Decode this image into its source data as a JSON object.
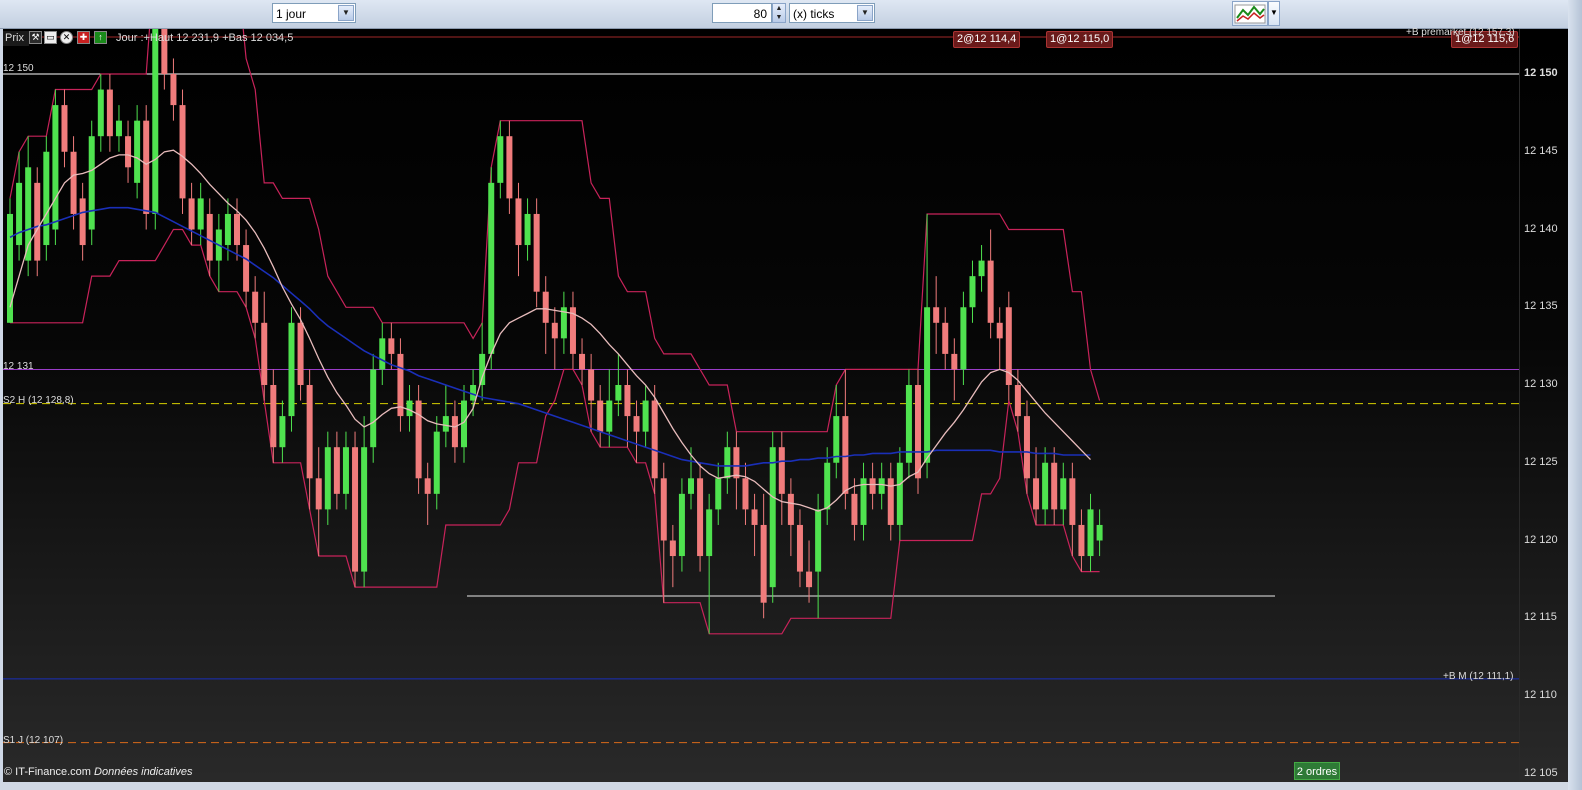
{
  "toolbar": {
    "period_value": "1 jour",
    "tick_count": "80",
    "tick_unit": "(x) ticks"
  },
  "chart_header": {
    "prix_label": "Prix",
    "info_text": "Jour :+Haut 12 231,9 +Bas 12 034,5"
  },
  "orders": [
    {
      "label": "2@12 114,4"
    },
    {
      "label": "1@12 115,0"
    },
    {
      "label": "1@12 115,6"
    }
  ],
  "level_labels": {
    "premarket": "+B premarket (12 157,3)",
    "l12150": "12 150",
    "l12131": "12 131",
    "s2h": "S2 H (12 128,8)",
    "bm": "+B M (12 111,1)",
    "s1j": "S1 J (12 107)"
  },
  "footer": {
    "brand": "© IT-Finance.com",
    "note": "Données indicatives",
    "orders_button": "2 ordres"
  },
  "colors": {
    "up": "#4fe24f",
    "down": "#f07c7c",
    "ma_blue": "#1a2fb8",
    "ma_pink": "#e8bcbc",
    "envelope": "#c8235a",
    "s2h": "#d8d000",
    "s1j": "#d86a1a",
    "bm": "#1a2fb8",
    "l12131": "#9a3cc8",
    "l12150": "#ffffff"
  },
  "chart_data": {
    "type": "candlestick",
    "y_ticks": [
      12150,
      12145,
      12140,
      12135,
      12130,
      12125,
      12120,
      12115,
      12110,
      12105
    ],
    "y_tick_labels": [
      "12 150",
      "12 145",
      "12 140",
      "12 135",
      "12 130",
      "12 125",
      "12 120",
      "12 115",
      "12 110",
      "12 105"
    ],
    "ylim": [
      12103.5,
      12155
    ],
    "levels": {
      "l12150": 12150,
      "l12131": 12131,
      "s2h": 12128.8,
      "bm": 12111.1,
      "s1j": 12107,
      "premarket": 12157.3
    },
    "candles": [
      {
        "o": 12134,
        "c": 12141,
        "h": 12142,
        "l": 12134
      },
      {
        "o": 12139,
        "c": 12143,
        "h": 12145,
        "l": 12138
      },
      {
        "o": 12138,
        "c": 12144,
        "h": 12146,
        "l": 12137
      },
      {
        "o": 12143,
        "c": 12138,
        "h": 12144,
        "l": 12137
      },
      {
        "o": 12139,
        "c": 12145,
        "h": 12146,
        "l": 12138
      },
      {
        "o": 12140,
        "c": 12148,
        "h": 12149,
        "l": 12139
      },
      {
        "o": 12148,
        "c": 12145,
        "h": 12149,
        "l": 12144
      },
      {
        "o": 12145,
        "c": 12141,
        "h": 12146,
        "l": 12140
      },
      {
        "o": 12142,
        "c": 12139,
        "h": 12143,
        "l": 12138
      },
      {
        "o": 12140,
        "c": 12146,
        "h": 12147,
        "l": 12139
      },
      {
        "o": 12146,
        "c": 12149,
        "h": 12150,
        "l": 12145
      },
      {
        "o": 12149,
        "c": 12146,
        "h": 12150,
        "l": 12145
      },
      {
        "o": 12146,
        "c": 12147,
        "h": 12148,
        "l": 12145
      },
      {
        "o": 12146,
        "c": 12144,
        "h": 12147,
        "l": 12143
      },
      {
        "o": 12143,
        "c": 12147,
        "h": 12148,
        "l": 12142
      },
      {
        "o": 12147,
        "c": 12141,
        "h": 12148,
        "l": 12140
      },
      {
        "o": 12141,
        "c": 12153,
        "h": 12158,
        "l": 12140
      },
      {
        "o": 12153,
        "c": 12150,
        "h": 12157,
        "l": 12149
      },
      {
        "o": 12150,
        "c": 12148,
        "h": 12151,
        "l": 12147
      },
      {
        "o": 12148,
        "c": 12142,
        "h": 12149,
        "l": 12141
      },
      {
        "o": 12142,
        "c": 12140,
        "h": 12143,
        "l": 12139
      },
      {
        "o": 12140,
        "c": 12142,
        "h": 12143,
        "l": 12139
      },
      {
        "o": 12141,
        "c": 12138,
        "h": 12142,
        "l": 12137
      },
      {
        "o": 12138,
        "c": 12140,
        "h": 12141,
        "l": 12136
      },
      {
        "o": 12139,
        "c": 12141,
        "h": 12142,
        "l": 12138
      },
      {
        "o": 12141,
        "c": 12139,
        "h": 12142,
        "l": 12138
      },
      {
        "o": 12139,
        "c": 12136,
        "h": 12140,
        "l": 12135
      },
      {
        "o": 12136,
        "c": 12134,
        "h": 12137,
        "l": 12133
      },
      {
        "o": 12134,
        "c": 12130,
        "h": 12136,
        "l": 12129
      },
      {
        "o": 12130,
        "c": 12126,
        "h": 12131,
        "l": 12125
      },
      {
        "o": 12126,
        "c": 12128,
        "h": 12129,
        "l": 12125
      },
      {
        "o": 12128,
        "c": 12134,
        "h": 12135,
        "l": 12127
      },
      {
        "o": 12134,
        "c": 12130,
        "h": 12135,
        "l": 12129
      },
      {
        "o": 12130,
        "c": 12124,
        "h": 12131,
        "l": 12122
      },
      {
        "o": 12124,
        "c": 12122,
        "h": 12126,
        "l": 12119
      },
      {
        "o": 12122,
        "c": 12126,
        "h": 12127,
        "l": 12121
      },
      {
        "o": 12126,
        "c": 12123,
        "h": 12127,
        "l": 12122
      },
      {
        "o": 12123,
        "c": 12126,
        "h": 12127,
        "l": 12122
      },
      {
        "o": 12126,
        "c": 12118,
        "h": 12127,
        "l": 12117
      },
      {
        "o": 12118,
        "c": 12126,
        "h": 12128,
        "l": 12117
      },
      {
        "o": 12126,
        "c": 12131,
        "h": 12132,
        "l": 12125
      },
      {
        "o": 12131,
        "c": 12133,
        "h": 12134,
        "l": 12130
      },
      {
        "o": 12133,
        "c": 12132,
        "h": 12134,
        "l": 12131
      },
      {
        "o": 12132,
        "c": 12128,
        "h": 12133,
        "l": 12127
      },
      {
        "o": 12128,
        "c": 12129,
        "h": 12130,
        "l": 12127
      },
      {
        "o": 12129,
        "c": 12124,
        "h": 12130,
        "l": 12123
      },
      {
        "o": 12124,
        "c": 12123,
        "h": 12125,
        "l": 12121
      },
      {
        "o": 12123,
        "c": 12127,
        "h": 12128,
        "l": 12122
      },
      {
        "o": 12127,
        "c": 12128,
        "h": 12130,
        "l": 12126
      },
      {
        "o": 12128,
        "c": 12126,
        "h": 12129,
        "l": 12125
      },
      {
        "o": 12126,
        "c": 12129,
        "h": 12130,
        "l": 12125
      },
      {
        "o": 12129,
        "c": 12130,
        "h": 12131,
        "l": 12128
      },
      {
        "o": 12130,
        "c": 12132,
        "h": 12134,
        "l": 12129
      },
      {
        "o": 12132,
        "c": 12143,
        "h": 12144,
        "l": 12131
      },
      {
        "o": 12143,
        "c": 12146,
        "h": 12147,
        "l": 12142
      },
      {
        "o": 12146,
        "c": 12142,
        "h": 12147,
        "l": 12141
      },
      {
        "o": 12142,
        "c": 12139,
        "h": 12143,
        "l": 12137
      },
      {
        "o": 12139,
        "c": 12141,
        "h": 12142,
        "l": 12138
      },
      {
        "o": 12141,
        "c": 12136,
        "h": 12142,
        "l": 12135
      },
      {
        "o": 12136,
        "c": 12134,
        "h": 12137,
        "l": 12132
      },
      {
        "o": 12134,
        "c": 12133,
        "h": 12135,
        "l": 12131
      },
      {
        "o": 12133,
        "c": 12135,
        "h": 12136,
        "l": 12132
      },
      {
        "o": 12135,
        "c": 12132,
        "h": 12136,
        "l": 12131
      },
      {
        "o": 12132,
        "c": 12131,
        "h": 12133,
        "l": 12130
      },
      {
        "o": 12131,
        "c": 12129,
        "h": 12132,
        "l": 12127
      },
      {
        "o": 12129,
        "c": 12127,
        "h": 12130,
        "l": 12126
      },
      {
        "o": 12127,
        "c": 12129,
        "h": 12131,
        "l": 12126
      },
      {
        "o": 12129,
        "c": 12130,
        "h": 12132,
        "l": 12128
      },
      {
        "o": 12130,
        "c": 12128,
        "h": 12131,
        "l": 12126
      },
      {
        "o": 12128,
        "c": 12127,
        "h": 12129,
        "l": 12125
      },
      {
        "o": 12127,
        "c": 12129,
        "h": 12130,
        "l": 12126
      },
      {
        "o": 12129,
        "c": 12124,
        "h": 12130,
        "l": 12123
      },
      {
        "o": 12124,
        "c": 12120,
        "h": 12125,
        "l": 12116
      },
      {
        "o": 12120,
        "c": 12119,
        "h": 12121,
        "l": 12117
      },
      {
        "o": 12119,
        "c": 12123,
        "h": 12124,
        "l": 12118
      },
      {
        "o": 12123,
        "c": 12124,
        "h": 12126,
        "l": 12122
      },
      {
        "o": 12124,
        "c": 12119,
        "h": 12125,
        "l": 12118
      },
      {
        "o": 12119,
        "c": 12122,
        "h": 12123,
        "l": 12114
      },
      {
        "o": 12122,
        "c": 12124,
        "h": 12125,
        "l": 12121
      },
      {
        "o": 12124,
        "c": 12126,
        "h": 12127,
        "l": 12123
      },
      {
        "o": 12126,
        "c": 12124,
        "h": 12127,
        "l": 12122
      },
      {
        "o": 12124,
        "c": 12122,
        "h": 12125,
        "l": 12121
      },
      {
        "o": 12122,
        "c": 12121,
        "h": 12123,
        "l": 12119
      },
      {
        "o": 12121,
        "c": 12116,
        "h": 12123,
        "l": 12115
      },
      {
        "o": 12117,
        "c": 12126,
        "h": 12127,
        "l": 12116
      },
      {
        "o": 12126,
        "c": 12123,
        "h": 12127,
        "l": 12121
      },
      {
        "o": 12123,
        "c": 12121,
        "h": 12124,
        "l": 12119
      },
      {
        "o": 12121,
        "c": 12118,
        "h": 12122,
        "l": 12117
      },
      {
        "o": 12118,
        "c": 12117,
        "h": 12120,
        "l": 12116
      },
      {
        "o": 12118,
        "c": 12122,
        "h": 12123,
        "l": 12115
      },
      {
        "o": 12122,
        "c": 12125,
        "h": 12126,
        "l": 12121
      },
      {
        "o": 12125,
        "c": 12128,
        "h": 12130,
        "l": 12124
      },
      {
        "o": 12128,
        "c": 12123,
        "h": 12131,
        "l": 12122
      },
      {
        "o": 12123,
        "c": 12121,
        "h": 12124,
        "l": 12120
      },
      {
        "o": 12121,
        "c": 12124,
        "h": 12125,
        "l": 12120
      },
      {
        "o": 12124,
        "c": 12123,
        "h": 12125,
        "l": 12122
      },
      {
        "o": 12123,
        "c": 12124,
        "h": 12125,
        "l": 12122
      },
      {
        "o": 12124,
        "c": 12121,
        "h": 12125,
        "l": 12120
      },
      {
        "o": 12121,
        "c": 12125,
        "h": 12126,
        "l": 12120
      },
      {
        "o": 12125,
        "c": 12130,
        "h": 12131,
        "l": 12124
      },
      {
        "o": 12130,
        "c": 12124,
        "h": 12131,
        "l": 12123
      },
      {
        "o": 12125,
        "c": 12135,
        "h": 12141,
        "l": 12124
      },
      {
        "o": 12135,
        "c": 12134,
        "h": 12137,
        "l": 12132
      },
      {
        "o": 12134,
        "c": 12132,
        "h": 12135,
        "l": 12131
      },
      {
        "o": 12132,
        "c": 12131,
        "h": 12133,
        "l": 12129
      },
      {
        "o": 12131,
        "c": 12135,
        "h": 12136,
        "l": 12130
      },
      {
        "o": 12135,
        "c": 12137,
        "h": 12138,
        "l": 12134
      },
      {
        "o": 12137,
        "c": 12138,
        "h": 12139,
        "l": 12136
      },
      {
        "o": 12138,
        "c": 12134,
        "h": 12140,
        "l": 12133
      },
      {
        "o": 12134,
        "c": 12133,
        "h": 12135,
        "l": 12131
      },
      {
        "o": 12135,
        "c": 12130,
        "h": 12136,
        "l": 12129
      },
      {
        "o": 12130,
        "c": 12128,
        "h": 12131,
        "l": 12127
      },
      {
        "o": 12128,
        "c": 12124,
        "h": 12129,
        "l": 12123
      },
      {
        "o": 12124,
        "c": 12122,
        "h": 12126,
        "l": 12121
      },
      {
        "o": 12122,
        "c": 12125,
        "h": 12126,
        "l": 12121
      },
      {
        "o": 12125,
        "c": 12122,
        "h": 12126,
        "l": 12121
      },
      {
        "o": 12122,
        "c": 12124,
        "h": 12125,
        "l": 12121
      },
      {
        "o": 12124,
        "c": 12121,
        "h": 12125,
        "l": 12119
      },
      {
        "o": 12121,
        "c": 12119,
        "h": 12122,
        "l": 12118
      },
      {
        "o": 12119,
        "c": 12122,
        "h": 12123,
        "l": 12118
      },
      {
        "o": 12120,
        "c": 12121,
        "h": 12122,
        "l": 12119
      }
    ],
    "ma_slow": [
      12139.5,
      12139.8,
      12140,
      12140.2,
      12140.3,
      12140.5,
      12140.7,
      12140.9,
      12141.1,
      12141.2,
      12141.3,
      12141.4,
      12141.4,
      12141.4,
      12141.3,
      12141.2,
      12141.1,
      12140.8,
      12140.5,
      12140.2,
      12139.9,
      12139.6,
      12139.3,
      12139,
      12138.7,
      12138.4,
      12138.1,
      12137.7,
      12137.3,
      12136.9,
      12136.4,
      12135.9,
      12135.4,
      12134.9,
      12134.3,
      12133.8,
      12133.4,
      12133,
      12132.6,
      12132.2,
      12131.9,
      12131.6,
      12131.3,
      12131.1,
      12130.9,
      12130.6,
      12130.4,
      12130.2,
      12130,
      12129.8,
      12129.6,
      12129.4,
      12129.2,
      12129.1,
      12129,
      12128.9,
      12128.8,
      12128.6,
      12128.4,
      12128.2,
      12128,
      12127.8,
      12127.6,
      12127.4,
      12127.2,
      12127,
      12126.8,
      12126.6,
      12126.4,
      12126.2,
      12126,
      12125.8,
      12125.6,
      12125.4,
      12125.2,
      12125.1,
      12125,
      12124.9,
      12124.8,
      12124.8,
      12124.8,
      12124.8,
      12124.9,
      12125,
      12125,
      12125.1,
      12125.1,
      12125.2,
      12125.2,
      12125.3,
      12125.3,
      12125.4,
      12125.4,
      12125.5,
      12125.5,
      12125.6,
      12125.6,
      12125.6,
      12125.7,
      12125.7,
      12125.7,
      12125.7,
      12125.8,
      12125.8,
      12125.8,
      12125.8,
      12125.8,
      12125.8,
      12125.8,
      12125.7,
      12125.7,
      12125.7,
      12125.7,
      12125.6,
      12125.6,
      12125.6,
      12125.5,
      12125.5,
      12125.5,
      12125.5
    ],
    "ma_fast": [
      12135,
      12137,
      12139,
      12140,
      12141,
      12142,
      12143,
      12143.5,
      12143.6,
      12143.8,
      12144.2,
      12144.6,
      12144.8,
      12144.8,
      12144.6,
      12144.2,
      12144.5,
      12145,
      12145.1,
      12144.7,
      12144.2,
      12143.6,
      12142.9,
      12142.3,
      12141.7,
      12141.2,
      12140.6,
      12139.8,
      12138.8,
      12137.6,
      12136.3,
      12135.2,
      12134.2,
      12133,
      12131.7,
      12130.5,
      12129.5,
      12128.7,
      12127.8,
      12127.3,
      12127.6,
      12128.1,
      12128.5,
      12128.6,
      12128.4,
      12128.1,
      12127.7,
      12127.5,
      12127.4,
      12127.3,
      12127.6,
      12128.5,
      12130.5,
      12132,
      12133.3,
      12134,
      12134.3,
      12134.6,
      12134.9,
      12134.9,
      12134.8,
      12134.7,
      12134.6,
      12134.3,
      12133.9,
      12133.3,
      12132.6,
      12132,
      12131.3,
      12130.6,
      12130,
      12129.2,
      12128.2,
      12127.2,
      12126.3,
      12125.5,
      12124.8,
      12124.3,
      12124,
      12124.1,
      12124.2,
      12124.1,
      12123.8,
      12123.3,
      12122.8,
      12122.5,
      12122.4,
      12122.3,
      12122.1,
      12121.9,
      12122.1,
      12122.6,
      12123.2,
      12123.5,
      12123.6,
      12123.6,
      12123.6,
      12123.5,
      12123.6,
      12124.1,
      12124.4,
      12125.3,
      12126.1,
      12126.9,
      12127.6,
      12128.4,
      12129.3,
      12130.2,
      12130.8,
      12131,
      12130.8,
      12130.3,
      12129.6,
      12128.9,
      12128.2,
      12127.6,
      12127,
      12126.4,
      12125.8,
      12125.2
    ]
  }
}
